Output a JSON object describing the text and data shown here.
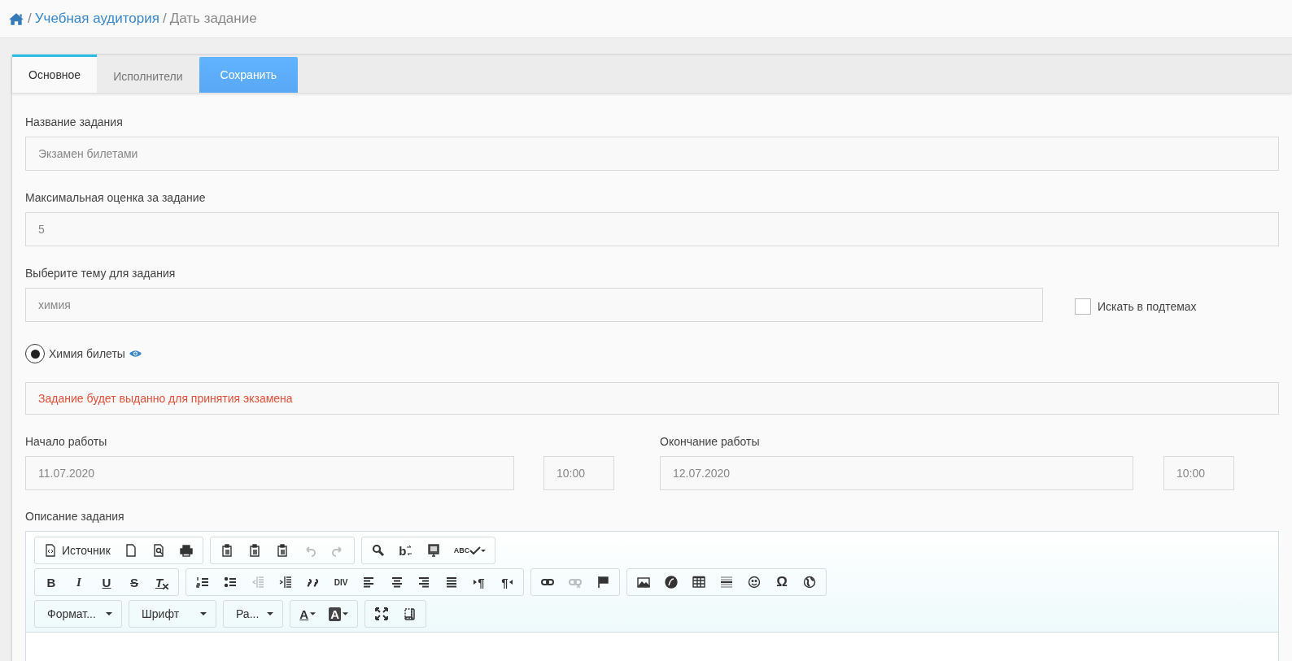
{
  "breadcrumb": [
    {
      "separator": "/",
      "label": "Учебная аудитория",
      "link": true
    },
    {
      "separator": "/",
      "label": "Дать задание",
      "link": false
    }
  ],
  "tabs": [
    {
      "label": "Основное",
      "selected": true
    },
    {
      "label": "Исполнители",
      "selected": false
    }
  ],
  "save_button": "Сохранить",
  "task_name": {
    "label": "Название задания",
    "placeholder": "Экзамен билетами"
  },
  "max_grade": {
    "label": "Максимальная оценка за задание",
    "placeholder": "5"
  },
  "topic": {
    "label": "Выберите тему для задания",
    "placeholder": "химия",
    "search_subtopics": {
      "label": "Искать в подтемах",
      "checked": false
    }
  },
  "topic_options": [
    {
      "label": "Химия билеты",
      "selected": true
    }
  ],
  "notice": "Задание будет выданно для принятия экзамена",
  "start": {
    "label": "Начало работы",
    "date": "11.07.2020",
    "time": "10:00"
  },
  "end": {
    "label": "Окончание работы",
    "date": "12.07.2020",
    "time": "10:00"
  },
  "description": {
    "label": "Описание задания",
    "toolbar_rows": [
      {
        "groups": [
          {
            "items": [
              {
                "kind": "source",
                "label": "Источник",
                "disabled": false
              },
              {
                "kind": "newpage",
                "disabled": false
              },
              {
                "kind": "preview",
                "disabled": false
              },
              {
                "kind": "print",
                "disabled": false
              }
            ]
          },
          {
            "items": [
              {
                "kind": "paste",
                "disabled": false
              },
              {
                "kind": "paste-text",
                "disabled": false
              },
              {
                "kind": "paste-word",
                "disabled": false
              },
              {
                "kind": "undo",
                "disabled": true
              },
              {
                "kind": "redo",
                "disabled": true
              }
            ]
          },
          {
            "items": [
              {
                "kind": "find",
                "disabled": false
              },
              {
                "kind": "replace",
                "label": "b",
                "disabled": false
              },
              {
                "kind": "select-all",
                "disabled": false
              },
              {
                "kind": "spellcheck",
                "label": "ABC",
                "disabled": false
              }
            ]
          }
        ]
      },
      {
        "groups": [
          {
            "items": [
              {
                "kind": "bold",
                "label": "B",
                "disabled": false
              },
              {
                "kind": "italic",
                "label": "I",
                "disabled": false
              },
              {
                "kind": "underline",
                "label": "U",
                "disabled": false
              },
              {
                "kind": "strike",
                "label": "S",
                "disabled": false
              },
              {
                "kind": "removeformat",
                "label": "T",
                "disabled": false
              }
            ]
          },
          {
            "items": [
              {
                "kind": "ol",
                "disabled": false
              },
              {
                "kind": "ul",
                "disabled": false
              },
              {
                "kind": "outdent",
                "disabled": true
              },
              {
                "kind": "indent",
                "disabled": false
              },
              {
                "kind": "quote",
                "disabled": false
              },
              {
                "kind": "div",
                "label": "DIV",
                "disabled": false
              },
              {
                "kind": "align-left",
                "disabled": false
              },
              {
                "kind": "align-center",
                "disabled": false
              },
              {
                "kind": "align-right",
                "disabled": false
              },
              {
                "kind": "justify",
                "disabled": false
              },
              {
                "kind": "ltr",
                "label": "¶",
                "disabled": false
              },
              {
                "kind": "rtl",
                "label": "¶",
                "disabled": false
              }
            ]
          },
          {
            "items": [
              {
                "kind": "link",
                "disabled": false
              },
              {
                "kind": "unlink",
                "disabled": true
              },
              {
                "kind": "anchor",
                "disabled": false
              }
            ]
          },
          {
            "items": [
              {
                "kind": "image",
                "disabled": false
              },
              {
                "kind": "flash",
                "disabled": false
              },
              {
                "kind": "table",
                "disabled": false
              },
              {
                "kind": "hr",
                "disabled": false
              },
              {
                "kind": "smiley",
                "disabled": false
              },
              {
                "kind": "special-char",
                "label": "Ω",
                "disabled": false
              },
              {
                "kind": "globe",
                "disabled": false
              }
            ]
          }
        ]
      },
      {
        "groups": [
          {
            "items": [
              {
                "kind": "combo",
                "label": "Формат...",
                "disabled": false
              }
            ]
          },
          {
            "items": [
              {
                "kind": "combo",
                "label": "Шрифт",
                "disabled": false
              }
            ]
          },
          {
            "items": [
              {
                "kind": "combo",
                "label": "Ра...",
                "disabled": false
              }
            ]
          },
          {
            "items": [
              {
                "kind": "text-color",
                "label": "A",
                "disabled": false
              },
              {
                "kind": "bg-color",
                "label": "A",
                "disabled": false
              }
            ]
          },
          {
            "items": [
              {
                "kind": "maximize",
                "disabled": false
              },
              {
                "kind": "showblocks",
                "disabled": false
              }
            ]
          }
        ]
      }
    ]
  }
}
